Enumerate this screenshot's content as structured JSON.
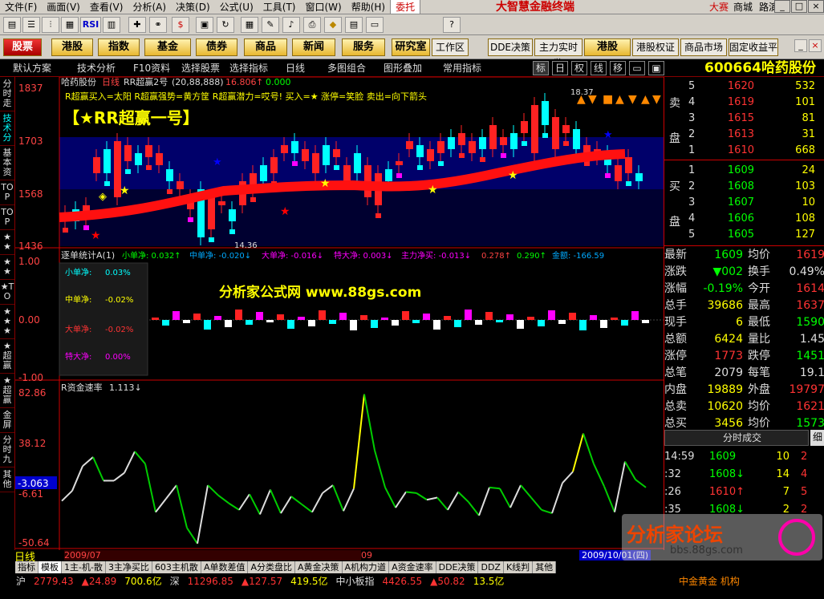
{
  "menu": {
    "items": [
      "文件(F)",
      "画面(V)",
      "查看(V)",
      "分析(A)",
      "决策(D)",
      "公式(U)",
      "工具(T)",
      "窗口(W)",
      "帮助(H)"
    ],
    "entrust": "委托",
    "app_title": "大智慧金融终端",
    "right": [
      "大赛",
      "商城",
      "路演"
    ]
  },
  "toolbar2": {
    "items": [
      "股票",
      "港股",
      "指数",
      "基金",
      "债券",
      "商品",
      "新闻",
      "服务",
      "研究室",
      "工作区",
      "DDE决策",
      "主力实时监",
      "港股",
      "港股权证",
      "商品市场",
      "固定收益平"
    ]
  },
  "toolbar3": {
    "items": [
      "默认方案",
      "技术分析",
      "F10资料",
      "选择股票",
      "选择指标",
      "日线",
      "多图组合",
      "图形叠加",
      "常用指标"
    ],
    "buttons": [
      "标",
      "日",
      "权",
      "线",
      "移"
    ]
  },
  "stock": {
    "code": "600664",
    "name": "哈药股份"
  },
  "left_tabs": [
    "分时走",
    "技术分",
    "基本资",
    "TOP",
    "TOP",
    "★★",
    "★★",
    "★TO",
    "★★★",
    "★超赢",
    "★超赢",
    "金屏",
    "分时九",
    "其他"
  ],
  "main_chart": {
    "header": "哈药股份",
    "period": "日线",
    "indicator": "RR超赢2号",
    "params": "(20,88,888)",
    "value1": "16.806",
    "arrow1": "↑",
    "value2": "0.000",
    "legend": "R超赢买入=太阳 R超赢强势=黄方筐 R超赢潜力=哎号! 买入=★ 涨停=笑脸 卖出=向下箭头",
    "big_title": "【★RR超赢一号】",
    "y_labels": [
      "1837",
      "1703",
      "1568",
      "1436"
    ],
    "high_label": "18.37",
    "low_label": "14.36",
    "markers": [
      "▲",
      "▼",
      "■",
      "▲",
      "▼",
      "▲",
      "▼"
    ]
  },
  "indicator1": {
    "title": "逐单统计A(1)",
    "items": [
      {
        "label": "小单净:",
        "value": "0.032↑"
      },
      {
        "label": "中单净:",
        "value": "-0.020↓"
      },
      {
        "label": "大单净:",
        "value": "-0.016↓"
      },
      {
        "label": "特大净:",
        "value": "0.003↓"
      },
      {
        "label": "主力净买:",
        "value": "-0.013↓"
      },
      {
        "label": "",
        "value": "0.278↑"
      },
      {
        "label": "",
        "value": "0.290↑"
      },
      {
        "label": "金额:",
        "value": "-166.59"
      }
    ],
    "y_labels": [
      "1.00",
      "0.00",
      "-1.00"
    ],
    "popup": [
      {
        "label": "小单净:",
        "value": "0.03%"
      },
      {
        "label": "中单净:",
        "value": "-0.02%"
      },
      {
        "label": "大单净:",
        "value": "-0.02%"
      },
      {
        "label": "特大净:",
        "value": "0.00%"
      }
    ],
    "watermark": "分析家公式网 www.88gs.com"
  },
  "indicator2": {
    "title": "R资金速率",
    "value": "1.113↓",
    "y_labels": [
      "82.86",
      "38.12",
      "-6.61",
      "-50.64"
    ],
    "cursor_value": "-3.063",
    "x_labels": [
      "2009/07",
      "09",
      "2009/10/01(四)"
    ],
    "period_label": "日线"
  },
  "chart_data": {
    "type": "line",
    "title": "R资金速率",
    "series": [
      {
        "name": "R资金速率",
        "values": [
          -14,
          -5,
          17,
          25,
          4,
          4,
          11,
          30,
          19,
          -24,
          -12,
          0,
          -38,
          -52,
          0,
          -9,
          -16,
          -22,
          -8,
          -26,
          -4,
          -25,
          -10,
          -17,
          -24,
          -7,
          0,
          -23,
          -3,
          81,
          31,
          -2,
          -20,
          -6,
          -7,
          -13,
          -11,
          -22,
          -6,
          -15,
          -27,
          -2,
          -3,
          -20,
          0,
          -11,
          -22,
          -25,
          2,
          12,
          46,
          19,
          -1,
          -24,
          21,
          5,
          -2
        ]
      }
    ]
  },
  "order_book": {
    "sell_label": [
      "卖",
      "盘"
    ],
    "buy_label": [
      "买",
      "盘"
    ],
    "sells": [
      {
        "lv": "5",
        "price": "1620",
        "vol": "532"
      },
      {
        "lv": "4",
        "price": "1619",
        "vol": "101"
      },
      {
        "lv": "3",
        "price": "1615",
        "vol": "81"
      },
      {
        "lv": "2",
        "price": "1613",
        "vol": "31"
      },
      {
        "lv": "1",
        "price": "1610",
        "vol": "668"
      }
    ],
    "buys": [
      {
        "lv": "1",
        "price": "1609",
        "vol": "24"
      },
      {
        "lv": "2",
        "price": "1608",
        "vol": "103"
      },
      {
        "lv": "3",
        "price": "1607",
        "vol": "10"
      },
      {
        "lv": "4",
        "price": "1606",
        "vol": "108"
      },
      {
        "lv": "5",
        "price": "1605",
        "vol": "127"
      }
    ]
  },
  "quote": [
    {
      "l1": "最新",
      "v1": "1609",
      "l2": "均价",
      "v2": "1619"
    },
    {
      "l1": "涨跌",
      "v1": "▼002",
      "l2": "换手",
      "v2": "0.49%"
    },
    {
      "l1": "涨幅",
      "v1": "-0.19%",
      "l2": "今开",
      "v2": "1614"
    },
    {
      "l1": "总手",
      "v1": "39686",
      "l2": "最高",
      "v2": "1637"
    },
    {
      "l1": "现手",
      "v1": "6",
      "l2": "最低",
      "v2": "1590"
    },
    {
      "l1": "总额",
      "v1": "6424",
      "l2": "量比",
      "v2": "1.45"
    },
    {
      "l1": "涨停",
      "v1": "1773",
      "l2": "跌停",
      "v2": "1451"
    },
    {
      "l1": "总笔",
      "v1": "2079",
      "l2": "每笔",
      "v2": "19.1"
    },
    {
      "l1": "内盘",
      "v1": "19889",
      "l2": "外盘",
      "v2": "19797"
    },
    {
      "l1": "总卖",
      "v1": "10620",
      "l2": "均价",
      "v2": "1621"
    },
    {
      "l1": "总买",
      "v1": "3456",
      "l2": "均价",
      "v2": "1573"
    }
  ],
  "ticks": {
    "title": "分时成交",
    "right": "细",
    "rows": [
      {
        "t": "14:59",
        "p": "1609",
        "a": "",
        "v": "10",
        "n": "2"
      },
      {
        "t": ":32",
        "p": "1608",
        "a": "↓",
        "v": "14",
        "n": "4"
      },
      {
        "t": ":26",
        "p": "1610",
        "a": "↑",
        "v": "7",
        "n": "5"
      },
      {
        "t": ":35",
        "p": "1608",
        "a": "↓",
        "v": "2",
        "n": "2"
      }
    ]
  },
  "bottom_tabs": [
    "指标",
    "模板",
    "1主-机-散",
    "3主净买比",
    "603主机散",
    "A单数差值",
    "A分类盘比",
    "A黄金决策",
    "A机构力道",
    "A资金速率",
    "DDE决策",
    "DDZ",
    "K线判",
    "其他"
  ],
  "status": {
    "row1": [
      "沪",
      "2779.43",
      "▲24.89",
      "700.6亿",
      "深",
      "11296.85",
      "▲127.57",
      "419.5亿",
      "中小板指",
      "4426.55",
      "▲50.82",
      "13.5亿"
    ],
    "row2": "中金黄金 机构"
  },
  "logo": {
    "text": "分析家论坛",
    "url": "bbs.88gs.com"
  }
}
